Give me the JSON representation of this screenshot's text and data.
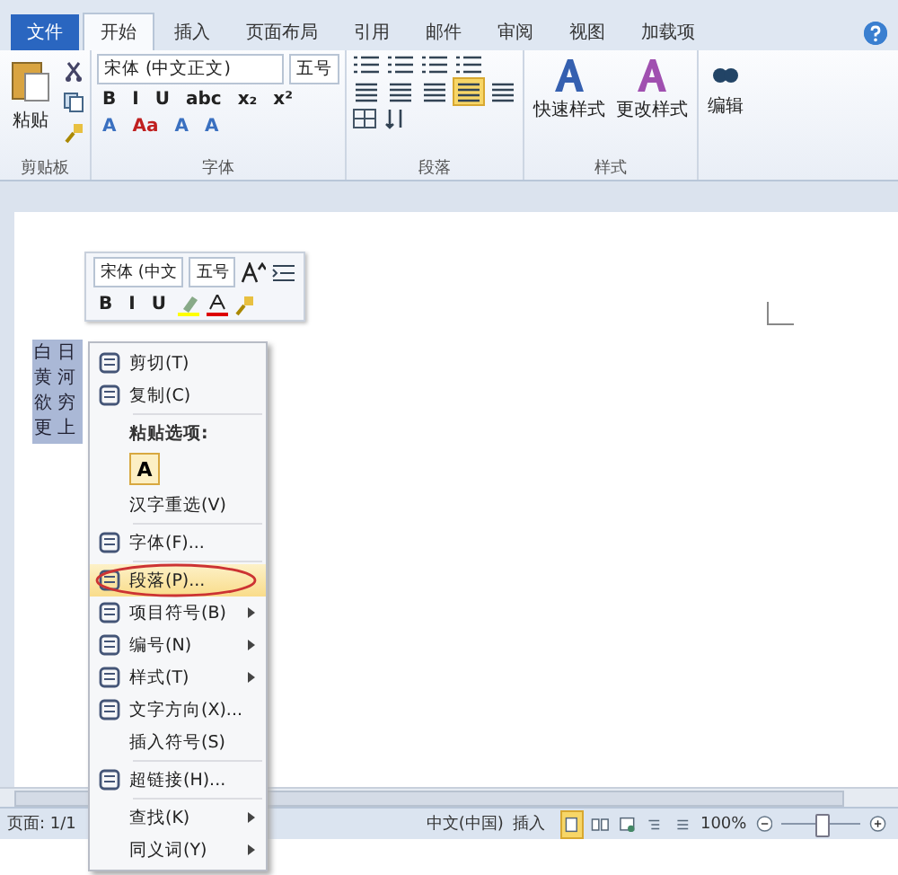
{
  "tabs": [
    {
      "label": "文件",
      "kind": "file",
      "selected": false
    },
    {
      "label": "开始",
      "kind": "tab",
      "selected": true
    },
    {
      "label": "插入",
      "kind": "tab",
      "selected": false
    },
    {
      "label": "页面布局",
      "kind": "tab",
      "selected": false
    },
    {
      "label": "引用",
      "kind": "tab",
      "selected": false
    },
    {
      "label": "邮件",
      "kind": "tab",
      "selected": false
    },
    {
      "label": "审阅",
      "kind": "tab",
      "selected": false
    },
    {
      "label": "视图",
      "kind": "tab",
      "selected": false
    },
    {
      "label": "加载项",
      "kind": "tab",
      "selected": false
    }
  ],
  "ribbon": {
    "clipboard": {
      "paste": "粘贴",
      "group": "剪贴板"
    },
    "font": {
      "font_name": "宋体 (中文正文)",
      "font_size": "五号",
      "row2": [
        "B",
        "I",
        "U",
        "abc",
        "x₂",
        "x²"
      ],
      "row3": [
        "A",
        "Aa",
        "A",
        "A"
      ],
      "group": "字体"
    },
    "paragraph": {
      "align_buttons": [
        {
          "selected": false
        },
        {
          "selected": false
        },
        {
          "selected": false
        },
        {
          "selected": true
        },
        {
          "selected": false
        }
      ],
      "group": "段落"
    },
    "styles": {
      "quick": "快速样式",
      "change": "更改样式",
      "group": "样式"
    },
    "editing": {
      "label": "编辑"
    }
  },
  "mini_toolbar": {
    "font_name": "宋体 (中文",
    "font_size": "五号",
    "buttons": [
      "B",
      "I",
      "U"
    ]
  },
  "document": {
    "lines": [
      "白日",
      "黄河",
      "欲穷",
      "更上"
    ]
  },
  "context_menu": [
    {
      "kind": "item",
      "label": "剪切(T)",
      "submenu": false,
      "selected": false
    },
    {
      "kind": "item",
      "label": "复制(C)",
      "submenu": false,
      "selected": false
    },
    {
      "kind": "header",
      "label": "粘贴选项:"
    },
    {
      "kind": "paste",
      "label": "A"
    },
    {
      "kind": "item",
      "label": "汉字重选(V)",
      "submenu": false,
      "selected": false
    },
    {
      "kind": "item",
      "label": "字体(F)...",
      "submenu": false,
      "selected": false
    },
    {
      "kind": "item",
      "label": "段落(P)...",
      "submenu": false,
      "selected": true
    },
    {
      "kind": "item",
      "label": "项目符号(B)",
      "submenu": true,
      "selected": false
    },
    {
      "kind": "item",
      "label": "编号(N)",
      "submenu": true,
      "selected": false
    },
    {
      "kind": "item",
      "label": "样式(T)",
      "submenu": true,
      "selected": false
    },
    {
      "kind": "item",
      "label": "文字方向(X)...",
      "submenu": false,
      "selected": false
    },
    {
      "kind": "item",
      "label": "插入符号(S)",
      "submenu": false,
      "selected": false
    },
    {
      "kind": "item",
      "label": "超链接(H)...",
      "submenu": false,
      "selected": false
    },
    {
      "kind": "item",
      "label": "查找(K)",
      "submenu": true,
      "selected": false
    },
    {
      "kind": "item",
      "label": "同义词(Y)",
      "submenu": true,
      "selected": false
    }
  ],
  "status_bar": {
    "page": "页面: 1/1",
    "language": "中文(中国)",
    "mode": "插入",
    "zoom": "100%",
    "zoom_slider": {
      "level": 0.5
    }
  }
}
